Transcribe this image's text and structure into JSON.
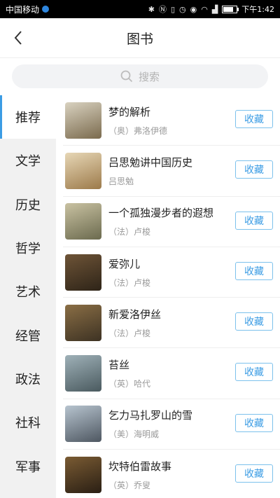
{
  "status_bar": {
    "carrier": "中国移动",
    "icons": [
      "bluetooth-icon",
      "nfc-icon",
      "vibrate-icon",
      "alarm-icon",
      "eye-icon",
      "wifi-icon",
      "signal-icon",
      "battery-icon"
    ],
    "battery_level": 0.8,
    "time": "下午1:42"
  },
  "header": {
    "title": "图书"
  },
  "search": {
    "placeholder": "搜索"
  },
  "sidebar": {
    "active_index": 0,
    "items": [
      {
        "label": "推荐"
      },
      {
        "label": "文学"
      },
      {
        "label": "历史"
      },
      {
        "label": "哲学"
      },
      {
        "label": "艺术"
      },
      {
        "label": "经管"
      },
      {
        "label": "政法"
      },
      {
        "label": "社科"
      },
      {
        "label": "军事"
      }
    ]
  },
  "books": [
    {
      "title": "梦的解析",
      "author": "（奥）弗洛伊德",
      "button": "收藏",
      "cover_colors": [
        "#d9d2c0",
        "#7a6a4d"
      ]
    },
    {
      "title": "吕思勉讲中国历史",
      "author": "吕思勉",
      "button": "收藏",
      "cover_colors": [
        "#e7d7b6",
        "#9c7a4a"
      ]
    },
    {
      "title": "一个孤独漫步者的遐想",
      "author": "（法）卢梭",
      "button": "收藏",
      "cover_colors": [
        "#c9c2a2",
        "#6b6a4e"
      ]
    },
    {
      "title": "爱弥儿",
      "author": "（法）卢梭",
      "button": "收藏",
      "cover_colors": [
        "#6e5437",
        "#2e2418"
      ]
    },
    {
      "title": "新爱洛伊丝",
      "author": "（法）卢梭",
      "button": "收藏",
      "cover_colors": [
        "#8a6e45",
        "#3d3223"
      ]
    },
    {
      "title": "苔丝",
      "author": "（英）哈代",
      "button": "收藏",
      "cover_colors": [
        "#9fb1b8",
        "#4a5a5f"
      ]
    },
    {
      "title": "乞力马扎罗山的雪",
      "author": "（美）海明威",
      "button": "收藏",
      "cover_colors": [
        "#b7c4cf",
        "#4e5761"
      ]
    },
    {
      "title": "坎特伯雷故事",
      "author": "（英）乔叟",
      "button": "收藏",
      "cover_colors": [
        "#7a5b33",
        "#2a1f14"
      ]
    }
  ]
}
